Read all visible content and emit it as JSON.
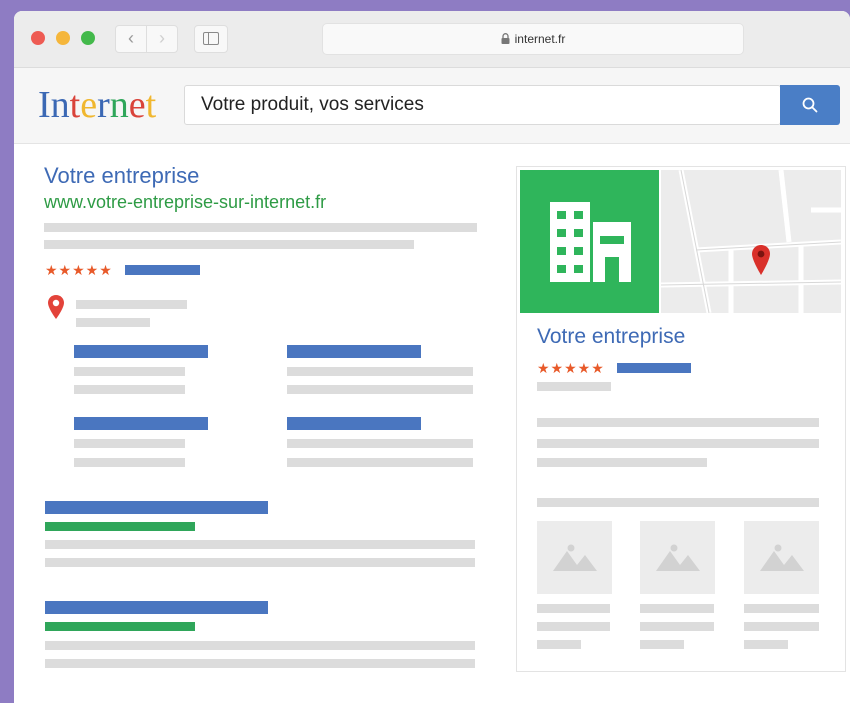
{
  "browser": {
    "address": "internet.fr",
    "back_icon": "chevron-left-icon",
    "forward_icon": "chevron-right-icon",
    "sidebar_icon": "sidebar-icon",
    "lock_icon": "lock-icon"
  },
  "header": {
    "logo_letters": [
      "I",
      "n",
      "t",
      "e",
      "r",
      "n",
      "e",
      "t"
    ],
    "logo_colors": [
      "#3b68b4",
      "#3b68b4",
      "#d9433a",
      "#f0b72f",
      "#3b68b4",
      "#2fa65a",
      "#d9433a",
      "#f0b72f"
    ],
    "search_value": "Votre produit, vos services",
    "search_icon": "search-icon"
  },
  "result": {
    "title": "Votre entreprise",
    "url": "www.votre-entreprise-sur-internet.fr",
    "stars": "★★★★★",
    "pin_icon": "map-pin-icon"
  },
  "panel": {
    "title": "Votre entreprise",
    "stars": "★★★★★",
    "building_icon": "building-icon",
    "map_pin_icon": "map-pin-icon",
    "image_icon": "image-placeholder-icon"
  },
  "colors": {
    "accent_blue": "#4a76c0",
    "link_green": "#2e9b45",
    "star_orange": "#e85a2a",
    "panel_green": "#2fb55b"
  }
}
